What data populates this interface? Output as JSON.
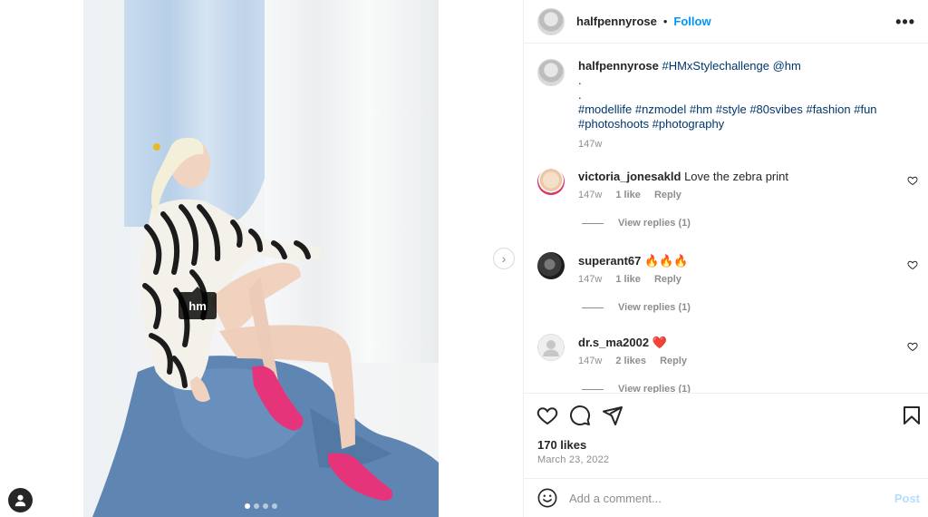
{
  "post": {
    "username": "halfpennyrose",
    "follow_label": "Follow",
    "separator": "•",
    "more_label": "•••",
    "media_tag": "hm",
    "carousel_count": 4,
    "carousel_active": 1,
    "caption": {
      "username": "halfpennyrose",
      "line1_tags": "#HMxStylechallenge @hm",
      "dot1": ".",
      "dot2": ".",
      "tags": "#modellife #nzmodel #hm #style #80svibes #fashion #fun #photoshoots #photography",
      "age": "147w"
    },
    "likes": "170 likes",
    "date": "March 23, 2022"
  },
  "comments": [
    {
      "username": "victoria_jonesakld",
      "text": "Love the zebra print",
      "age": "147w",
      "likes": "1 like",
      "reply": "Reply",
      "replies": "View replies (1)"
    },
    {
      "username": "superant67",
      "text": "🔥🔥🔥",
      "age": "147w",
      "likes": "1 like",
      "reply": "Reply",
      "replies": "View replies (1)"
    },
    {
      "username": "dr.s_ma2002",
      "text": "❤️",
      "age": "147w",
      "likes": "2 likes",
      "reply": "Reply",
      "replies": "View replies (1)"
    }
  ],
  "add_comment": {
    "placeholder": "Add a comment...",
    "post_label": "Post"
  },
  "icons": {
    "like": "heart-icon",
    "comment": "speech-bubble-icon",
    "share": "paper-plane-icon",
    "save": "bookmark-icon",
    "emoji": "smiley-icon",
    "next": "chevron-right-icon",
    "profile": "user-icon"
  },
  "colors": {
    "link_blue": "#0095f6",
    "hashtag": "#00376b",
    "muted": "#8e8e8e",
    "post_disabled": "#b2dffc"
  }
}
